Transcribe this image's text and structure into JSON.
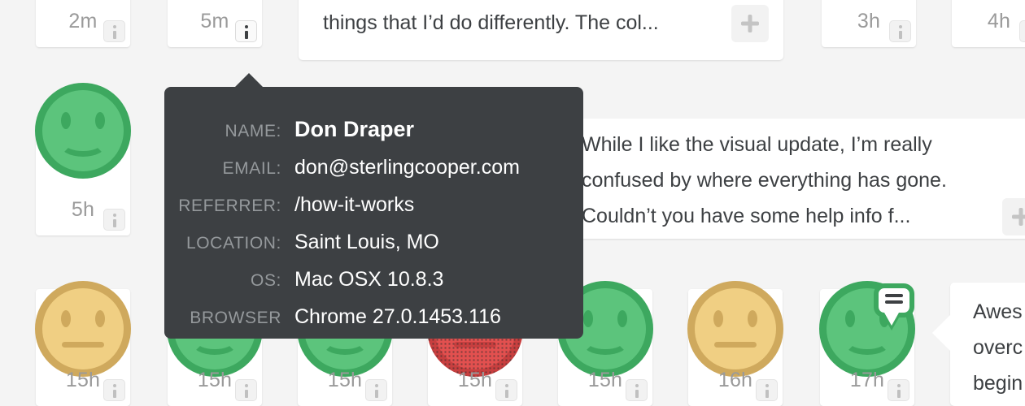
{
  "theme": {
    "background": "#f4f4f4",
    "card_bg": "#ffffff",
    "tooltip_bg": "#3d4043",
    "happy_fill": "#5cc47c",
    "happy_ring": "#3da85f",
    "neutral_fill": "#f0cf83",
    "neutral_ring": "#cfa95d",
    "angry_fill": "#e2504f",
    "angry_ring": "#c83f3f",
    "muted_text": "#9a9a9a",
    "body_text": "#3d4043"
  },
  "tooltip": {
    "rows": [
      {
        "key": "NAME:",
        "value": "Don Draper",
        "strong": true
      },
      {
        "key": "EMAIL:",
        "value": "don@sterlingcooper.com",
        "strong": false
      },
      {
        "key": "REFERRER:",
        "value": "/how-it-works",
        "strong": false
      },
      {
        "key": "LOCATION:",
        "value": "Saint Louis, MO",
        "strong": false
      },
      {
        "key": "OS:",
        "value": "Mac OSX 10.8.3",
        "strong": false
      },
      {
        "key": "BROWSER",
        "value": "Chrome 27.0.1453.116",
        "strong": false
      }
    ]
  },
  "cards": {
    "row_top": [
      {
        "time": "2m",
        "mood": "neutral",
        "info_active": false
      },
      {
        "time": "5m",
        "mood": "happy",
        "info_active": true
      },
      {
        "time": "3h",
        "mood": "happy",
        "info_active": false
      },
      {
        "time": "4h",
        "mood": "happy",
        "info_active": false
      }
    ],
    "row_middle": [
      {
        "time": "5h",
        "mood": "happy",
        "info_active": false
      }
    ],
    "row_bottom": [
      {
        "time": "15h",
        "mood": "neutral",
        "info_active": false,
        "badge": false
      },
      {
        "time": "15h",
        "mood": "happy",
        "info_active": false,
        "badge": false
      },
      {
        "time": "15h",
        "mood": "happy",
        "info_active": false,
        "badge": false
      },
      {
        "time": "15h",
        "mood": "angry",
        "info_active": false,
        "badge": false
      },
      {
        "time": "15h",
        "mood": "happy",
        "info_active": false,
        "badge": false
      },
      {
        "time": "16h",
        "mood": "neutral",
        "info_active": false,
        "badge": false
      },
      {
        "time": "17h",
        "mood": "happy",
        "info_active": false,
        "badge": true
      }
    ]
  },
  "comments": {
    "top": {
      "text": "the site. I think there aren’t too many\nthings that I’d do differently. The col...",
      "expand_label": "+"
    },
    "middle": {
      "text": "While I like the visual update, I’m really\nconfused by where everything has gone.\nCouldn’t you have some help info f...",
      "expand_label": "+"
    },
    "right": {
      "text": "Awes\noverc\nbegin"
    }
  },
  "icons": {
    "info": "info-icon",
    "plus": "plus-icon",
    "chat": "chat-bubble-icon"
  }
}
